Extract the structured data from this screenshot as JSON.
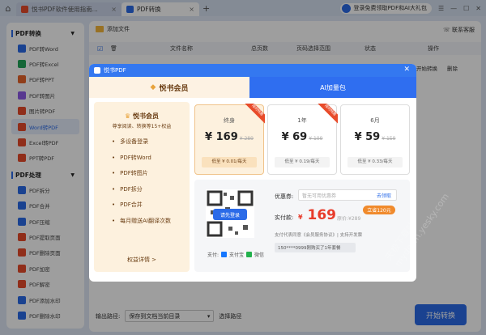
{
  "titlebar": {
    "tabs": [
      {
        "label": "悦书PDF软件使用指南...",
        "active": false
      },
      {
        "label": "PDF转换",
        "active": true
      }
    ],
    "login_label": "登录免费领取PDF和AI大礼包"
  },
  "sidebar": {
    "sections": [
      {
        "title": "PDF转换",
        "items": [
          "PDF转Word",
          "PDF转Excel",
          "PDF转PPT",
          "PDF转图片",
          "图片转PDF",
          "Word转PDF",
          "Excel转PDF",
          "PPT转PDF"
        ]
      },
      {
        "title": "PDF处理",
        "items": [
          "PDF拆分",
          "PDF合并",
          "PDF压缩",
          "PDF提取页面",
          "PDF删除页面",
          "PDF加密",
          "PDF解密",
          "PDF添加水印",
          "PDF删除水印"
        ]
      }
    ],
    "active_item": "Word转PDF"
  },
  "main": {
    "add_file": "添加文件",
    "feedback": "联系客服",
    "columns": [
      "文件名称",
      "总页数",
      "页码选择范围",
      "状态",
      "操作"
    ],
    "row_actions": [
      "开始转换",
      "删除"
    ],
    "output_label": "输出路径:",
    "output_value": "保存到文档当前目录",
    "choose_path": "选择路径",
    "start_button": "开始转换"
  },
  "modal": {
    "header": "悦书PDF",
    "tab_member": "悦书会员",
    "tab_ai": "AI加量包",
    "benefits_title": "悦书会员",
    "benefits_subtitle": "尊享阅读、转换等15+权益",
    "benefits": [
      "多设备登录",
      "PDF转Word",
      "PDF转图片",
      "PDF拆分",
      "PDF合并",
      "每月赠送AI翻译次数"
    ],
    "benefits_detail": "权益详情 >",
    "plans": [
      {
        "name": "终身",
        "price": "¥ 169",
        "orig": "¥ 289",
        "per": "低至 ¥ 0.01/每天",
        "ribbon": "限时特惠",
        "selected": true
      },
      {
        "name": "1年",
        "price": "¥ 69",
        "orig": "¥ 109",
        "per": "低至 ¥ 0.19/每天",
        "ribbon": "限时特惠",
        "selected": false
      },
      {
        "name": "6月",
        "price": "¥ 59",
        "orig": "¥ 159",
        "per": "低至 ¥ 0.33/每天",
        "ribbon": "",
        "selected": false
      }
    ],
    "qr_login": "请先登录",
    "pay_label": "支付:",
    "alipay": "支付宝",
    "wechat": "微信",
    "coupon_label": "优惠券:",
    "coupon_placeholder": "暂无可用优惠券",
    "coupon_link": "去领取",
    "paid_label": "实付款:",
    "paid_currency": "¥",
    "paid_amount": "169",
    "paid_orig": "原价:¥289",
    "save_badge": "立省120元",
    "agree_text": "支付代表同意《会员服务协议》| 支持开发票",
    "notice_text": "150****0999刚购买了1年套餐"
  },
  "watermark": "天极下载站 mydown.yesky.com",
  "colors": {
    "accent": "#2b6be8",
    "price_red": "#e83c2b",
    "gold": "#6b3e14"
  }
}
